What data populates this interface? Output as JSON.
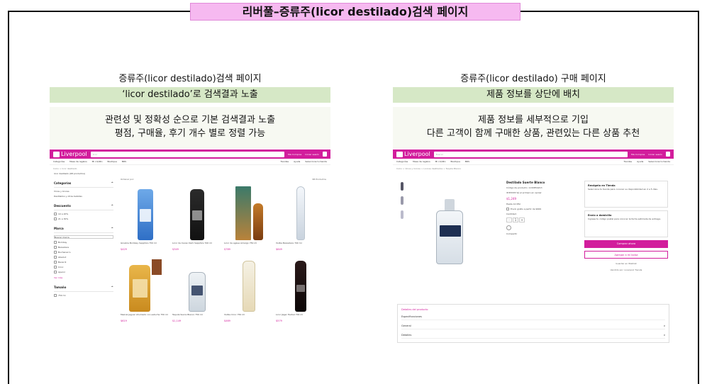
{
  "page": {
    "title": "리버풀–증류주(licor destilado)검색 페이지"
  },
  "left": {
    "heading": "증류주(licor destilado)검색 페이지",
    "band": "‘licor destilado’로 검색결과 노출",
    "desc": [
      "관련성 및 정확성 순으로 기본 검색결과 노출",
      "평점, 구매율, 후기 개수 별로 정렬 가능"
    ],
    "shot": {
      "logo": "Liverpool",
      "search_placeholder": "licor",
      "topbar_links": [
        "Mis Compras",
        "Iniciar sesión"
      ],
      "subnav": [
        "Categorías",
        "Mesa de regalos",
        "Mi crédito",
        "Boutique",
        "BRS",
        "Tiendas",
        "Ayuda"
      ],
      "subnav_right": "Selecciona tu tienda",
      "breadcrumb": "Inicio > licor destilado",
      "result_label": "licor destilado (68 productos)",
      "sort": "Ordenar por:",
      "count": "68 Productos",
      "sidebar": {
        "categories_title": "Categorías",
        "categories": [
          "Vinos y licores",
          "Destilados y otras bebidas"
        ],
        "discount_title": "Descuento",
        "discounts": [
          "10 a 20%",
          "21 a 30%"
        ],
        "brand_title": "Marca",
        "brand_search": "Buscar marca",
        "brands": [
          "Bombay",
          "Belvedere",
          "Buchanan's",
          "Absolut",
          "Bacardi",
          "Ciroc",
          "Aperol"
        ],
        "more": "Ver más",
        "size_title": "Tamaño",
        "sizes": [
          "750 ml"
        ]
      },
      "products": [
        {
          "name": "Ginebra Bombay Sapphire 750 ml",
          "price": "$429"
        },
        {
          "name": "Licor de Cacao Dark Sapphire 700 ml",
          "price": "$349"
        },
        {
          "name": "Licor de agave Amargo 750 ml",
          "price": "$789"
        },
        {
          "name": "Vodka Belvedere 700 ml",
          "price": "$649"
        },
        {
          "name": "Mezcal Jaguar Ahumado con estuche 750 ml",
          "price": "$619"
        },
        {
          "name": "Tequila Sierra Blanco 750 ml",
          "price": "$1,149"
        },
        {
          "name": "Vodka Ciroc 750 ml",
          "price": "$469"
        },
        {
          "name": "Licor Jäger Herbal 700 ml",
          "price": "$579"
        }
      ]
    }
  },
  "right": {
    "heading": "증류주(licor destilado) 구매 페이지",
    "band": "제품 정보를 상단에 배치",
    "desc": [
      "제품 정보를 세부적으로 기입",
      "다른 고객이 함께 구매한 상품, 관련있는 다른 상품 추천"
    ],
    "shot": {
      "logo": "Liverpool",
      "search_placeholder": "Buscar",
      "topbar_links": [
        "Mis Compras",
        "Iniciar sesión"
      ],
      "subnav": [
        "Categorías",
        "Mesa de regalos",
        "Mi crédito",
        "Boutique",
        "BRS",
        "Tiendas",
        "Ayuda"
      ],
      "subnav_right": "Selecciona tu tienda",
      "breadcrumb": "Inicio > Vinos y licores > Licores destilados > Tequila Blanco",
      "product_title": "Destilado Suerte Blanco",
      "product_sub": "Código de producto: 1132854213",
      "rating": "★★★★★ Sé el primero en opinar",
      "price": "$1,249",
      "msi": "Hasta 12 MSI",
      "gift": "Envío gratis a partir de $999",
      "qty_label": "Cantidad:",
      "qty": [
        "-",
        "1",
        "+"
      ],
      "share": "Compartir",
      "delivery_title": "Recógelo en Tienda",
      "delivery_text": "Selecciona tu tienda para conocer su disponibilidad en 2 a 5 días.",
      "ship_title": "Envío a domicilio",
      "ship_text": "Ingresa tu código postal para conocer la fecha estimada de entrega.",
      "btn_buy": "Comprar ahora",
      "btn_cart": "Agregar a mi bolsa",
      "btn_wish": "Guardar en Wishlist",
      "seller": "Vendido por: Liverpool Tienda",
      "details_title": "Detalles del producto",
      "specs": "Especificaciones",
      "general": "General",
      "more": "Detalles"
    }
  },
  "colors": {
    "accent": "#d21d9c",
    "band": "#d6e8c6",
    "title_bg": "#f6b9f0"
  }
}
